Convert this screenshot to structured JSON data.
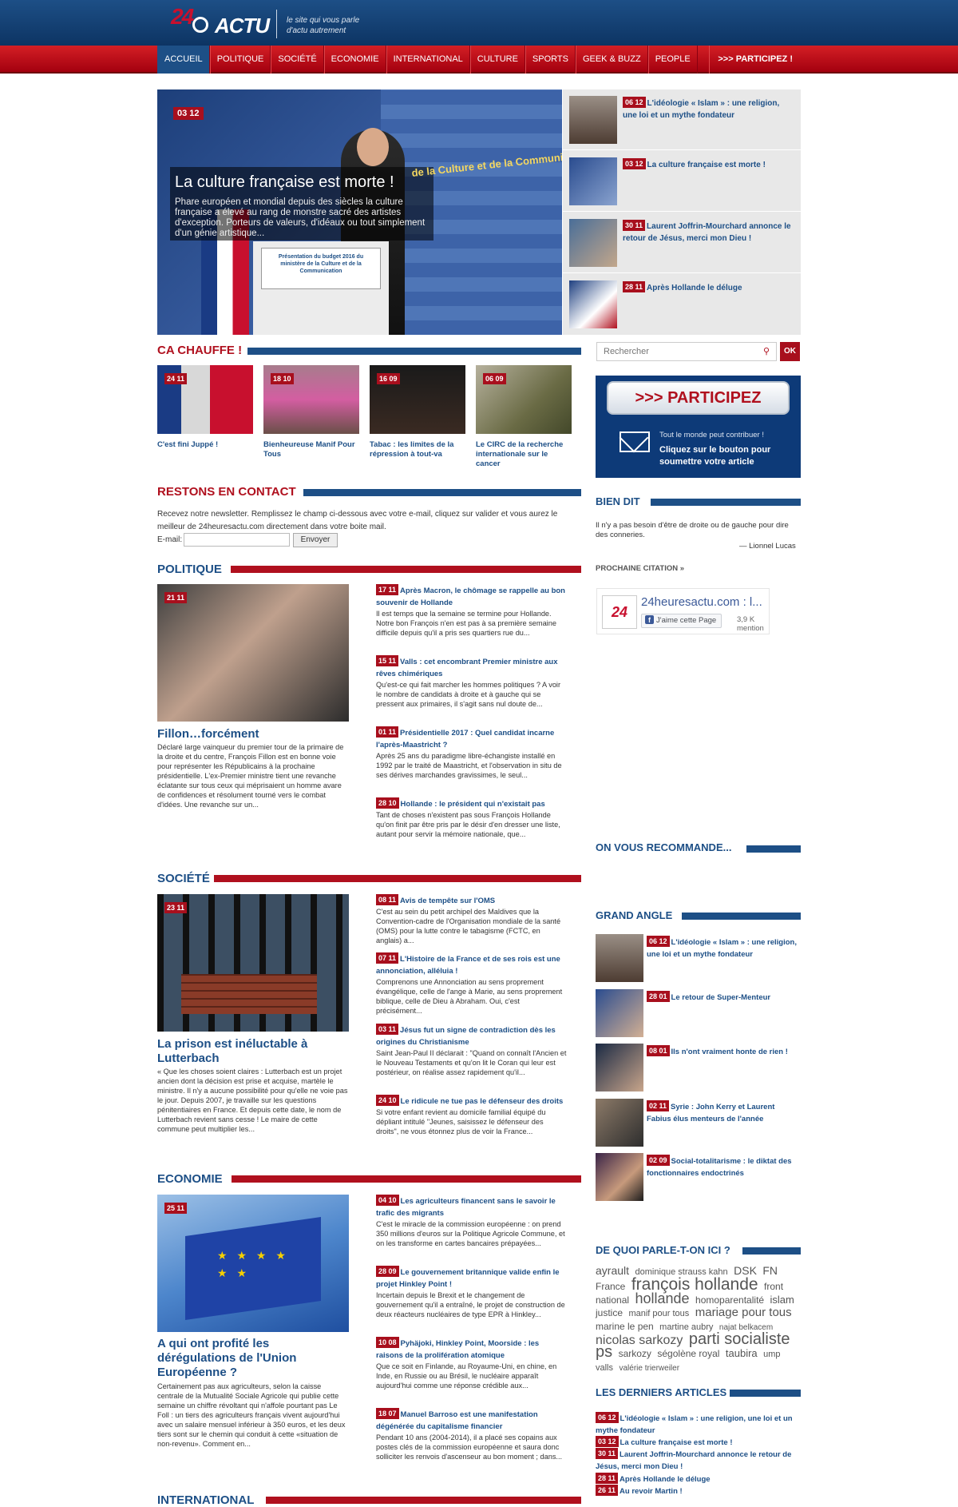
{
  "header": {
    "logo_text": "ACTU",
    "logo_number": "24",
    "tagline_1": "le site qui vous parle",
    "tagline_2": "d'actu autrement"
  },
  "nav": {
    "items": [
      "ACCUEIL",
      "POLITIQUE",
      "SOCIÉTÉ",
      "ECONOMIE",
      "INTERNATIONAL",
      "CULTURE",
      "SPORTS",
      "GEEK & BUZZ",
      "PEOPLE"
    ],
    "cta": ">>> PARTICIPEZ !"
  },
  "hero": {
    "date": "03 12",
    "title": "La culture française est morte !",
    "excerpt": "Phare européen et mondial depuis des siècles la culture française a élevé au rang de monstre sacré des artistes d'exception. Porteurs de valeurs, d'idéaux ou tout simplement d'un génie artistique...",
    "sign": "Présentation du budget 2016 du ministère de la Culture et de la Communication",
    "wall": "de la Culture et de la Communication"
  },
  "hero_list": [
    {
      "date": "06 12",
      "title": "L'idéologie « Islam » : une religion, une loi et un mythe fondateur"
    },
    {
      "date": "03 12",
      "title": "La culture française est morte !"
    },
    {
      "date": "30 11",
      "title": "Laurent Joffrin-Mourchard annonce le retour de Jésus, merci mon Dieu !"
    },
    {
      "date": "28 11",
      "title": "Après Hollande le déluge"
    }
  ],
  "ca_chauffe": {
    "heading": "CA CHAUFFE !",
    "items": [
      {
        "date": "24 11",
        "title": "C'est fini Juppé !"
      },
      {
        "date": "18 10",
        "title": "Bienheureuse Manif Pour Tous"
      },
      {
        "date": "16 09",
        "title": "Tabac : les limites de la répression à tout-va"
      },
      {
        "date": "06 09",
        "title": "Le CIRC de la recherche internationale sur le cancer"
      }
    ]
  },
  "contact": {
    "heading": "RESTONS EN CONTACT",
    "text": "Recevez notre newsletter. Remplissez le champ ci-dessous avec votre e-mail, cliquez sur valider et vous aurez le meilleur de 24heuresactu.com directement dans votre boite mail.",
    "email_label": "E-mail:",
    "submit": "Envoyer"
  },
  "politique": {
    "heading": "POLITIQUE",
    "main": {
      "date": "21 11",
      "title": "Fillon…forcément",
      "excerpt": "Déclaré large vainqueur du premier tour de la primaire de la droite et du centre, François Fillon est en bonne voie pour représenter les Républicains à la prochaine présidentielle. L'ex-Premier ministre tient une revanche éclatante sur tous ceux qui méprisaient un homme avare de confidences et résolument tourné vers le combat d'idées. Une revanche sur un..."
    },
    "list": [
      {
        "date": "17 11",
        "title": "Après Macron, le chômage se rappelle au bon souvenir de Hollande",
        "excerpt": "Il est temps que la semaine se termine pour Hollande. Notre bon François n'en est pas à sa première semaine difficile depuis qu'il a pris ses quartiers rue du..."
      },
      {
        "date": "15 11",
        "title": "Valls : cet encombrant Premier ministre aux rêves chimériques",
        "excerpt": "Qu'est-ce qui fait marcher les hommes politiques ? A voir le nombre de candidats à droite et à gauche qui se pressent aux primaires, il s'agit sans nul doute de..."
      },
      {
        "date": "01 11",
        "title": "Présidentielle 2017 : Quel candidat incarne l'après-Maastricht ?",
        "excerpt": "Après 25 ans du paradigme libre-échangiste installé en 1992 par le traité de Maastricht, et l'observation in situ de ses dérives marchandes gravissimes, le seul..."
      },
      {
        "date": "28 10",
        "title": "Hollande : le président qui n'existait pas",
        "excerpt": "Tant de choses n'existent pas sous François Hollande qu'on finit par être pris par le désir d'en dresser une liste, autant pour servir la mémoire nationale, que..."
      }
    ]
  },
  "societe": {
    "heading": "SOCIÉTÉ",
    "main": {
      "date": "23 11",
      "title": "La prison est inéluctable à Lutterbach",
      "excerpt": "« Que les choses soient claires : Lutterbach est un projet ancien dont la décision est prise et acquise, martèle le ministre. Il n'y a aucune possibilité pour qu'elle ne voie pas le jour. Depuis 2007, je travaille sur les questions pénitentiaires en France. Et depuis cette date, le nom de Lutterbach revient sans cesse ! Le maire de cette commune peut multiplier les..."
    },
    "list": [
      {
        "date": "08 11",
        "title": "Avis de tempête sur l'OMS",
        "excerpt": "C'est au sein du petit archipel des Maldives que la Convention-cadre de l'Organisation mondiale de la santé (OMS) pour la lutte contre le tabagisme (FCTC, en anglais) a..."
      },
      {
        "date": "07 11",
        "title": "L'Histoire de la France et de ses rois est une annonciation, alléluia !",
        "excerpt": "Comprenons une Annonciation au sens proprement évangélique, celle de l'ange à Marie, au sens proprement biblique, celle de Dieu à Abraham. Oui, c'est précisément..."
      },
      {
        "date": "03 11",
        "title": "Jésus fut un signe de contradiction dès les origines du Christianisme",
        "excerpt": "Saint Jean-Paul II déclarait : \"Quand on connaît l'Ancien et le Nouveau Testaments et qu'on lit le Coran qui leur est postérieur, on réalise assez rapidement qu'il..."
      },
      {
        "date": "24 10",
        "title": "Le ridicule ne tue pas le défenseur des droits",
        "excerpt": "Si votre enfant revient au domicile familial équipé du dépliant intitulé \"Jeunes, saisissez le défenseur des droits\", ne vous étonnez plus de voir la France..."
      }
    ]
  },
  "economie": {
    "heading": "ECONOMIE",
    "main": {
      "date": "25 11",
      "title": "A qui ont profité les dérégulations de l'Union Européenne ?",
      "excerpt": "Certainement pas aux agriculteurs, selon la caisse centrale de la Mutualité Sociale Agricole qui publie cette semaine un chiffre révoltant qui n'affole pourtant pas Le Foll : un tiers des agriculteurs français vivent aujourd'hui avec un salaire mensuel inférieur à 350 euros, et les deux tiers sont sur le chemin qui conduit à cette «situation de non-revenu». Comment en..."
    },
    "list": [
      {
        "date": "04 10",
        "title": "Les agriculteurs financent sans le savoir le trafic des migrants",
        "excerpt": "C'est le miracle de la commission européenne : on prend 350 millions d'euros sur la Politique Agricole Commune, et on les transforme en cartes bancaires prépayées..."
      },
      {
        "date": "28 09",
        "title": "Le gouvernement britannique valide enfin le projet Hinkley Point !",
        "excerpt": "Incertain depuis le Brexit et le changement de gouvernement qu'il a entraîné, le projet de construction de deux réacteurs nucléaires de type EPR à Hinkley..."
      },
      {
        "date": "10 08",
        "title": "Pyhäjoki, Hinkley Point, Moorside : les raisons de la prolifération atomique",
        "excerpt": "Que ce soit en Finlande, au Royaume-Uni, en chine, en Inde, en Russie ou au Brésil, le nucléaire apparaît aujourd'hui comme une réponse crédible aux..."
      },
      {
        "date": "18 07",
        "title": "Manuel Barroso est une manifestation dégénérée du capitalisme financier",
        "excerpt": "Pendant 10 ans (2004-2014), il a placé ses copains aux postes clés de la commission européenne et saura donc solliciter les renvois d'ascenseur au bon moment ; dans..."
      }
    ]
  },
  "international": {
    "heading": "INTERNATIONAL"
  },
  "sidebar": {
    "search_placeholder": "Rechercher",
    "search_btn": "OK",
    "participez": {
      "button": ">>> PARTICIPEZ",
      "line1": "Tout le monde peut contribuer !",
      "line2": "Cliquez sur le bouton pour soumettre votre article"
    },
    "bien_dit": {
      "heading": "BIEN DIT",
      "quote": "Il n'y a pas besoin d'être de droite ou de gauche pour dire des conneries.",
      "author": "— Lionnel Lucas",
      "next": "PROCHAINE CITATION »"
    },
    "facebook": {
      "name": "24heuresactu.com : l...",
      "like": "J'aime cette Page",
      "count": "3,9 K mention"
    },
    "recommande": {
      "heading": "ON VOUS RECOMMANDE..."
    },
    "grand_angle": {
      "heading": "GRAND ANGLE",
      "items": [
        {
          "date": "06 12",
          "title": "L'idéologie « Islam » : une religion, une loi et un mythe fondateur"
        },
        {
          "date": "28 01",
          "title": "Le retour de Super-Menteur"
        },
        {
          "date": "08 01",
          "title": "Ils n'ont vraiment honte de rien !"
        },
        {
          "date": "02 11",
          "title": "Syrie : John Kerry et Laurent Fabius élus menteurs de l'année"
        },
        {
          "date": "02 09",
          "title": "Social-totalitarisme : le diktat des fonctionnaires endoctrinés"
        }
      ]
    },
    "tags": {
      "heading": "DE QUOI PARLE-T-ON ICI ?",
      "items": [
        {
          "t": "ayrault",
          "s": 14
        },
        {
          "t": "dominique strauss kahn",
          "s": 11
        },
        {
          "t": "DSK",
          "s": 14
        },
        {
          "t": "FN",
          "s": 14
        },
        {
          "t": "France",
          "s": 12
        },
        {
          "t": "françois hollande",
          "s": 21
        },
        {
          "t": "front national",
          "s": 12
        },
        {
          "t": "hollande",
          "s": 18
        },
        {
          "t": "homoparentalité",
          "s": 12
        },
        {
          "t": "islam",
          "s": 13
        },
        {
          "t": "justice",
          "s": 12
        },
        {
          "t": "manif pour tous",
          "s": 11
        },
        {
          "t": "mariage pour tous",
          "s": 15
        },
        {
          "t": "marine le pen",
          "s": 12
        },
        {
          "t": "martine aubry",
          "s": 11
        },
        {
          "t": "najat belkacem",
          "s": 10
        },
        {
          "t": "nicolas sarkozy",
          "s": 16
        },
        {
          "t": "parti socialiste",
          "s": 20
        },
        {
          "t": "ps",
          "s": 20
        },
        {
          "t": "sarkozy",
          "s": 12
        },
        {
          "t": "ségolène royal",
          "s": 12
        },
        {
          "t": "taubira",
          "s": 13
        },
        {
          "t": "ump",
          "s": 11
        },
        {
          "t": "valls",
          "s": 11
        },
        {
          "t": "valérie trierweiler",
          "s": 10
        }
      ]
    },
    "derniers": {
      "heading": "LES DERNIERS ARTICLES",
      "items": [
        {
          "date": "06 12",
          "title": "L'idéologie « Islam » : une religion, une loi et un mythe fondateur"
        },
        {
          "date": "03 12",
          "title": "La culture française est morte !"
        },
        {
          "date": "30 11",
          "title": "Laurent Joffrin-Mourchard annonce le retour de Jésus, merci mon Dieu !"
        },
        {
          "date": "28 11",
          "title": "Après Hollande le déluge"
        },
        {
          "date": "26 11",
          "title": "Au revoir Martin !"
        }
      ]
    }
  }
}
